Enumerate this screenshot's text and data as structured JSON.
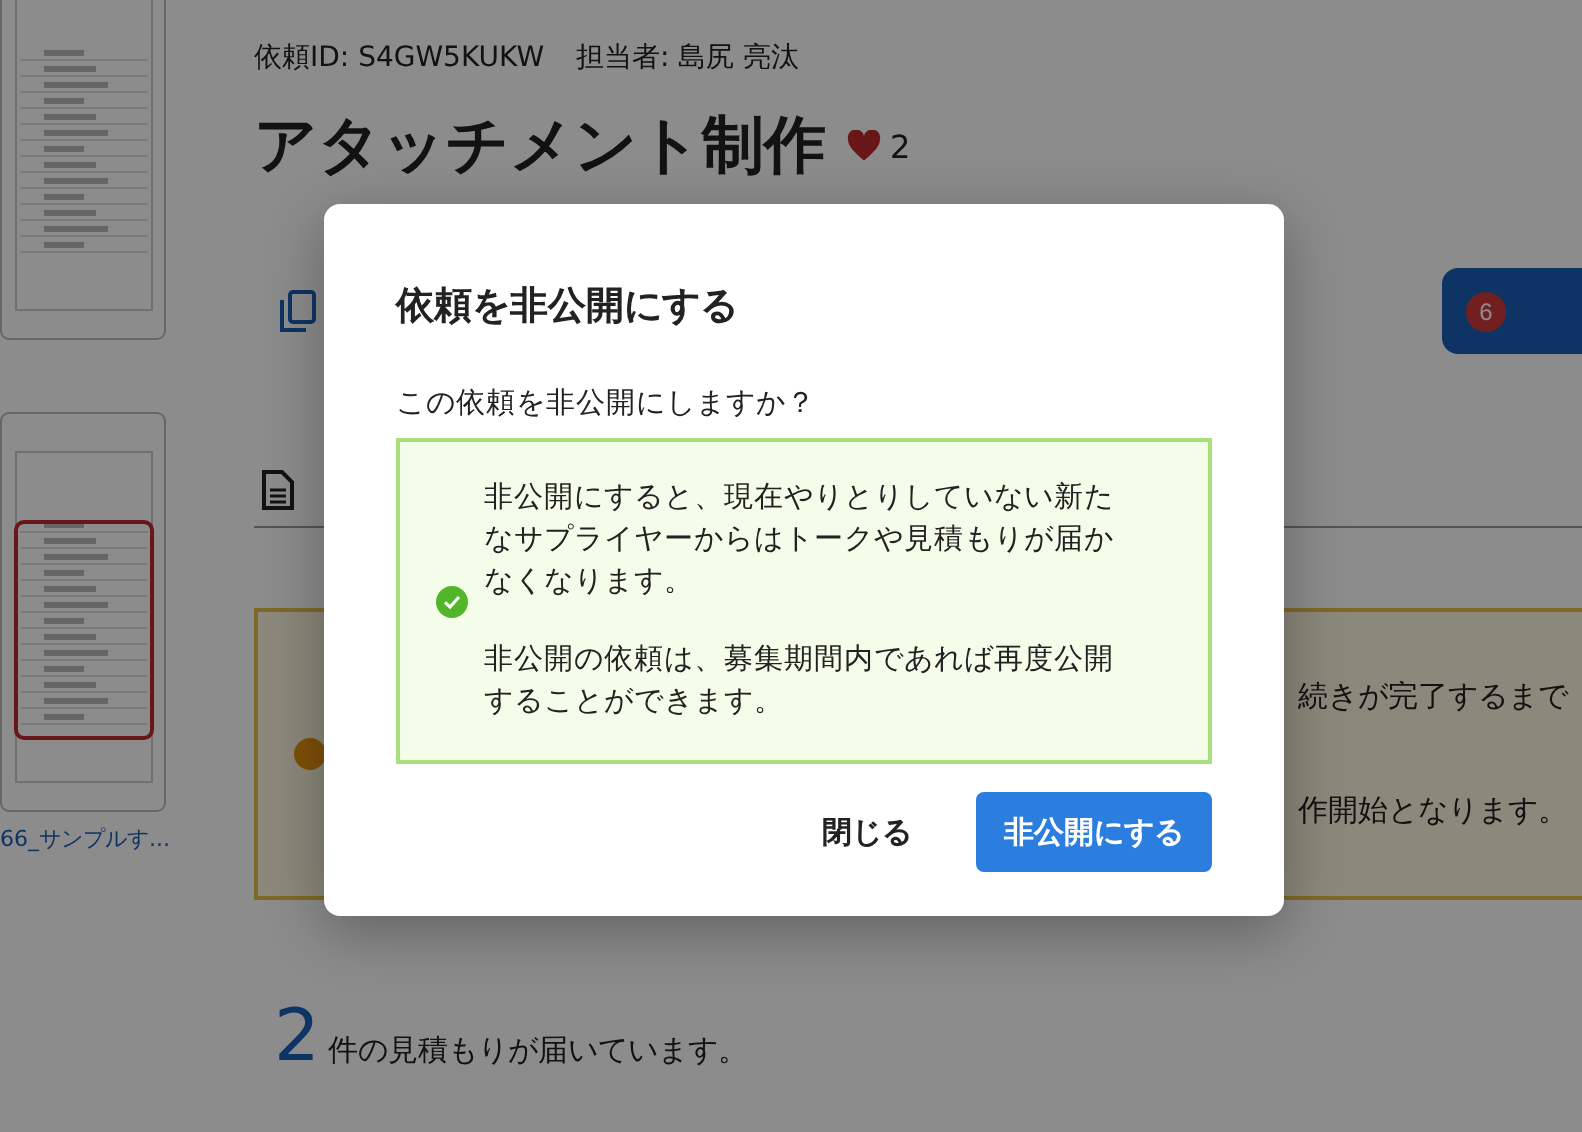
{
  "sidebar": {
    "thumbnails": [
      {
        "highlighted": false
      },
      {
        "highlighted": true,
        "filename": "66_サンプルす..."
      }
    ]
  },
  "heading": {
    "request_id": "依頼ID: S4GW5KUKW",
    "assignee": "担当者: 島尻 亮汰",
    "title": "アタッチメント制作",
    "likes": "2"
  },
  "actions": {
    "badge": "6"
  },
  "notice": {
    "lines": [
      "続きが完了するまで",
      "作開始となります。"
    ]
  },
  "quotes": {
    "count": "2",
    "text": "件の見積もりが届いています。"
  },
  "dialog": {
    "title": "依頼を非公開にする",
    "question": "この依頼を非公開にしますか？",
    "info": [
      "非公開にすると、現在やりとりしていない新たなサプライヤーからはトークや見積もりが届かなくなります。",
      "非公開の依頼は、募集期間内であれば再度公開することができます。"
    ],
    "buttons": [
      {
        "label": "閉じる",
        "kind": "text"
      },
      {
        "label": "非公開にする",
        "kind": "primary"
      }
    ]
  }
}
